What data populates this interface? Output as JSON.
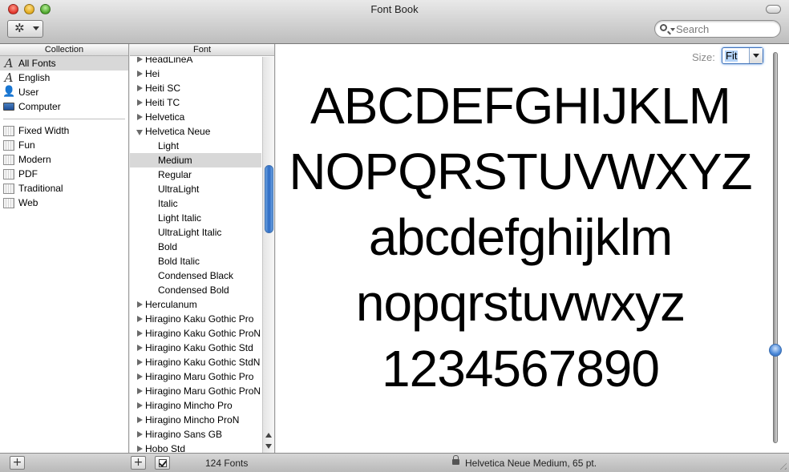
{
  "window": {
    "title": "Font Book"
  },
  "toolbar": {
    "action_icon": "gear-icon",
    "search": {
      "placeholder": "Search",
      "value": ""
    }
  },
  "collection_column": {
    "header": "Collection",
    "group1": [
      {
        "label": "All Fonts",
        "icon": "font-icon",
        "glyph": "A",
        "selected": true
      },
      {
        "label": "English",
        "icon": "font-icon",
        "glyph": "A",
        "selected": false
      },
      {
        "label": "User",
        "icon": "user-icon",
        "glyph": "👤",
        "selected": false
      },
      {
        "label": "Computer",
        "icon": "computer-icon",
        "glyph": "",
        "selected": false
      }
    ],
    "group2": [
      {
        "label": "Fixed Width",
        "icon": "collection-book-icon"
      },
      {
        "label": "Fun",
        "icon": "collection-book-icon"
      },
      {
        "label": "Modern",
        "icon": "collection-book-icon"
      },
      {
        "label": "PDF",
        "icon": "collection-book-icon"
      },
      {
        "label": "Traditional",
        "icon": "collection-book-icon"
      },
      {
        "label": "Web",
        "icon": "collection-book-icon"
      }
    ]
  },
  "font_column": {
    "header": "Font",
    "items": [
      {
        "label": "HeadLineA",
        "kind": "family"
      },
      {
        "label": "Hei",
        "kind": "family"
      },
      {
        "label": "Heiti SC",
        "kind": "family"
      },
      {
        "label": "Heiti TC",
        "kind": "family"
      },
      {
        "label": "Helvetica",
        "kind": "family"
      },
      {
        "label": "Helvetica Neue",
        "kind": "family-open"
      },
      {
        "label": "Light",
        "kind": "face"
      },
      {
        "label": "Medium",
        "kind": "face",
        "selected": true
      },
      {
        "label": "Regular",
        "kind": "face"
      },
      {
        "label": "UltraLight",
        "kind": "face"
      },
      {
        "label": "Italic",
        "kind": "face"
      },
      {
        "label": "Light Italic",
        "kind": "face"
      },
      {
        "label": "UltraLight Italic",
        "kind": "face"
      },
      {
        "label": "Bold",
        "kind": "face"
      },
      {
        "label": "Bold Italic",
        "kind": "face"
      },
      {
        "label": "Condensed Black",
        "kind": "face"
      },
      {
        "label": "Condensed Bold",
        "kind": "face"
      },
      {
        "label": "Herculanum",
        "kind": "family"
      },
      {
        "label": "Hiragino Kaku Gothic Pro",
        "kind": "family"
      },
      {
        "label": "Hiragino Kaku Gothic ProN",
        "kind": "family"
      },
      {
        "label": "Hiragino Kaku Gothic Std",
        "kind": "family"
      },
      {
        "label": "Hiragino Kaku Gothic StdN",
        "kind": "family"
      },
      {
        "label": "Hiragino Maru Gothic Pro",
        "kind": "family"
      },
      {
        "label": "Hiragino Maru Gothic ProN",
        "kind": "family"
      },
      {
        "label": "Hiragino Mincho Pro",
        "kind": "family"
      },
      {
        "label": "Hiragino Mincho ProN",
        "kind": "family"
      },
      {
        "label": "Hiragino Sans GB",
        "kind": "family"
      },
      {
        "label": "Hobo Std",
        "kind": "family"
      }
    ]
  },
  "preview": {
    "size_label": "Size:",
    "size_value": "Fit",
    "sample_lines": [
      "ABCDEFGHIJKLM",
      "NOPQRSTUVWXYZ",
      "abcdefghijklm",
      "nopqrstuvwxyz",
      "1234567890"
    ],
    "size_slider_level": 0.77
  },
  "bottom_bar": {
    "add_collection_label": "+",
    "add_font_label": "+",
    "font_count": "124 Fonts",
    "status": "Helvetica Neue Medium, 65 pt."
  },
  "colors": {
    "selection_gray": "#d8d8d8",
    "accent_blue": "#2c6bc5"
  }
}
